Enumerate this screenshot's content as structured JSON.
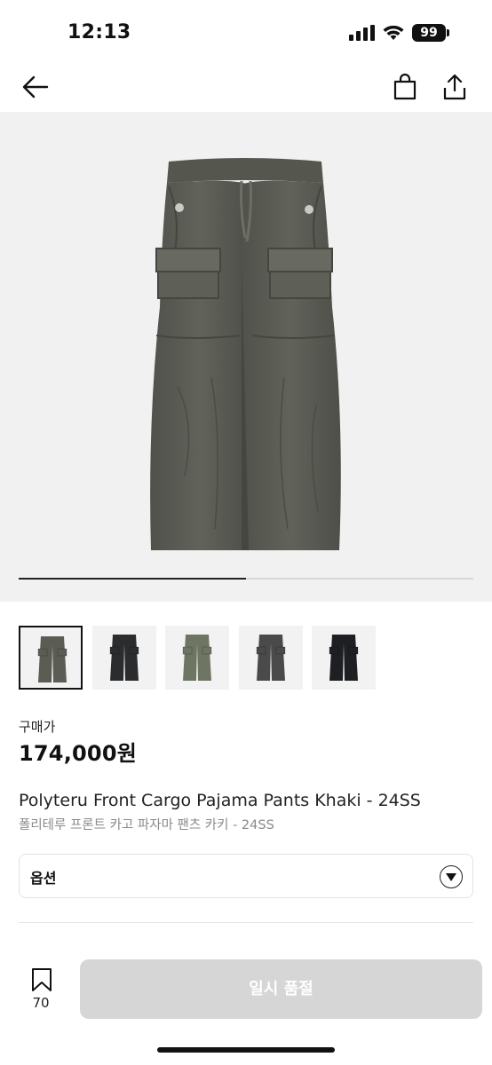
{
  "status_bar": {
    "time": "12:13",
    "battery": "99"
  },
  "nav": {
    "back_icon": "arrow-left-icon",
    "cart_icon": "shopping-bag-icon",
    "share_icon": "share-icon"
  },
  "gallery": {
    "current_image": 1,
    "image_count": 2,
    "colors": {
      "background": "#f1f1f1",
      "pants_main": "#5b5d55"
    }
  },
  "thumbnails": [
    {
      "color": "#5b5d55",
      "selected": true
    },
    {
      "color": "#2b2c2e",
      "selected": false
    },
    {
      "color": "#6e7562",
      "selected": false
    },
    {
      "color": "#4a4a4a",
      "selected": false
    },
    {
      "color": "#1e1f22",
      "selected": false
    }
  ],
  "product": {
    "price_label": "구매가",
    "price": "174,000원",
    "title_en": "Polyteru Front Cargo Pajama Pants Khaki - 24SS",
    "title_ko": "폴리테루 프론트 카고 파자마 팬츠 카키 - 24SS"
  },
  "option": {
    "label": "옵션",
    "icon": "chevron-down-icon"
  },
  "bottom": {
    "wishlist_count": "70",
    "wishlist_icon": "bookmark-icon",
    "soldout_label": "일시 품절",
    "soldout_color": "#d6d6d6"
  }
}
